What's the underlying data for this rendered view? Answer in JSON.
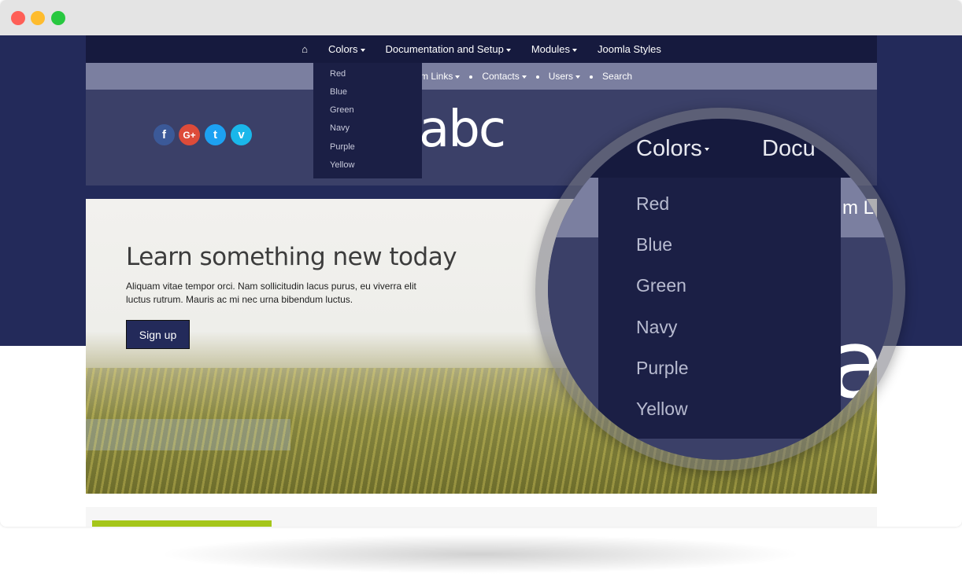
{
  "window": {
    "controls": [
      {
        "name": "close",
        "color": "#fe5f57"
      },
      {
        "name": "minimize",
        "color": "#febc2e"
      },
      {
        "name": "maximize",
        "color": "#28c840"
      }
    ]
  },
  "nav": {
    "home_icon": "home-icon",
    "items": [
      {
        "label": "Colors"
      },
      {
        "label": "Documentation and Setup"
      },
      {
        "label": "Modules"
      },
      {
        "label": "Joomla Styles"
      }
    ]
  },
  "subnav": {
    "items": [
      "m Links",
      "Contacts",
      "Users",
      "Search"
    ]
  },
  "dropdown": {
    "items": [
      "Red",
      "Blue",
      "Green",
      "Navy",
      "Purple",
      "Yellow"
    ]
  },
  "social": [
    {
      "icon": "facebook-icon",
      "glyph": "f",
      "color": "#3b5998"
    },
    {
      "icon": "google-plus-icon",
      "glyph": "G+",
      "color": "#dd4b39"
    },
    {
      "icon": "twitter-icon",
      "glyph": "t",
      "color": "#1da1f2"
    },
    {
      "icon": "vimeo-icon",
      "glyph": "v",
      "color": "#1ab7ea"
    }
  ],
  "logo": "abc",
  "hero": {
    "title": "Learn something new today",
    "text": "Aliquam vitae tempor orci. Nam sollicitudin lacus purus, eu viverra elit luctus rutrum. Mauris ac mi nec urna bibendum luctus.",
    "button": "Sign up"
  },
  "magnifier": {
    "colors": "Colors",
    "docu": "Docu",
    "sub": "m L",
    "items": [
      "Red",
      "Blue",
      "Green",
      "Navy",
      "Purple",
      "Yellow"
    ]
  },
  "colors": {
    "navy": "#232a5a",
    "accent": "#a5c61a"
  }
}
